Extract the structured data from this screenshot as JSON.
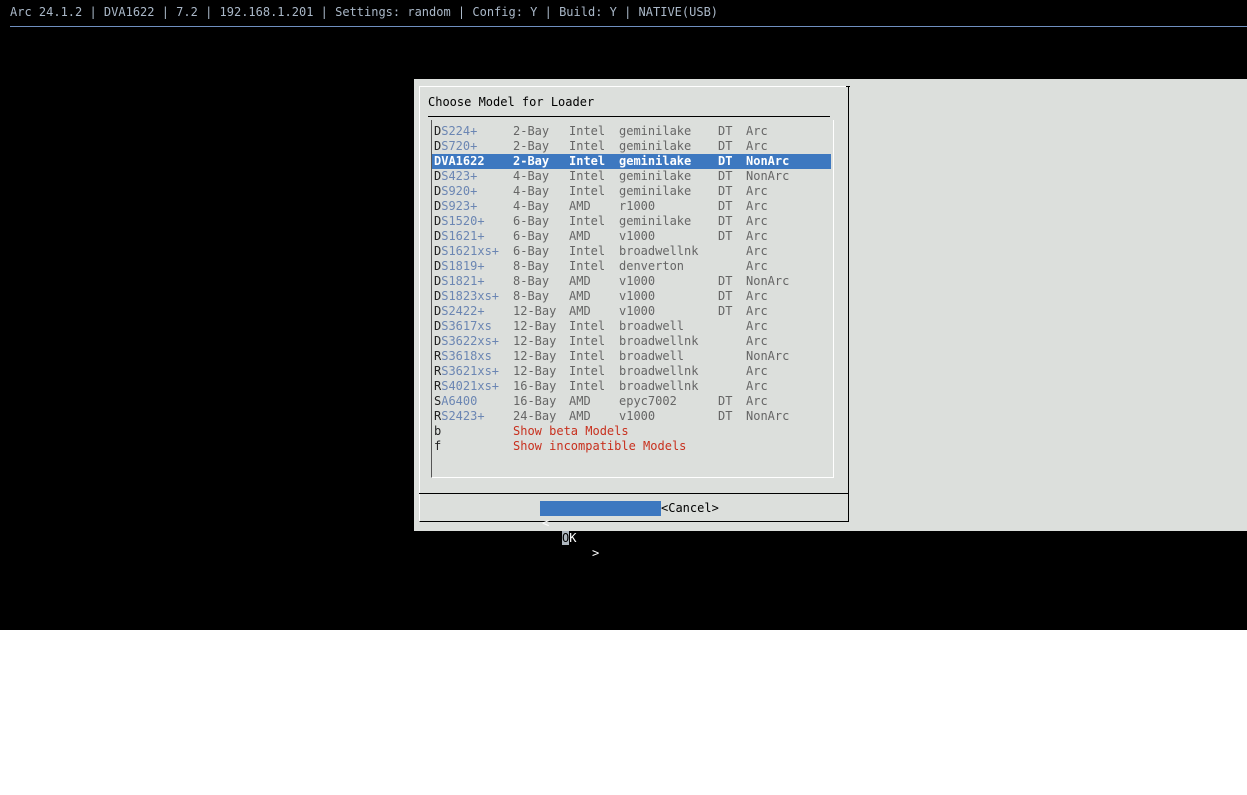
{
  "status_bar": "Arc 24.1.2 | DVA1622 | 7.2 | 192.168.1.201 | Settings: random | Config: Y | Build: Y | NATIVE(USB)",
  "dialog": {
    "title": "Choose Model for Loader",
    "ok_prefix": "<",
    "ok_label_hot": "O",
    "ok_label_rest": "K",
    "ok_suffix": ">",
    "cancel_label": "<Cancel>"
  },
  "models": [
    {
      "key": "D",
      "rest": "S224+",
      "bays": "2-Bay",
      "cpu": "Intel",
      "platform": "geminilake",
      "dt": "DT",
      "arc": "Arc"
    },
    {
      "key": "D",
      "rest": "S720+",
      "bays": "2-Bay",
      "cpu": "Intel",
      "platform": "geminilake",
      "dt": "DT",
      "arc": "Arc"
    },
    {
      "key": "D",
      "rest": "VA1622",
      "bays": "2-Bay",
      "cpu": "Intel",
      "platform": "geminilake",
      "dt": "DT",
      "arc": "NonArc",
      "selected": true
    },
    {
      "key": "D",
      "rest": "S423+",
      "bays": "4-Bay",
      "cpu": "Intel",
      "platform": "geminilake",
      "dt": "DT",
      "arc": "NonArc"
    },
    {
      "key": "D",
      "rest": "S920+",
      "bays": "4-Bay",
      "cpu": "Intel",
      "platform": "geminilake",
      "dt": "DT",
      "arc": "Arc"
    },
    {
      "key": "D",
      "rest": "S923+",
      "bays": "4-Bay",
      "cpu": "AMD",
      "platform": "r1000",
      "dt": "DT",
      "arc": "Arc"
    },
    {
      "key": "D",
      "rest": "S1520+",
      "bays": "6-Bay",
      "cpu": "Intel",
      "platform": "geminilake",
      "dt": "DT",
      "arc": "Arc"
    },
    {
      "key": "D",
      "rest": "S1621+",
      "bays": "6-Bay",
      "cpu": "AMD",
      "platform": "v1000",
      "dt": "DT",
      "arc": "Arc"
    },
    {
      "key": "D",
      "rest": "S1621xs+",
      "bays": "6-Bay",
      "cpu": "Intel",
      "platform": "broadwellnk",
      "dt": "",
      "arc": "Arc"
    },
    {
      "key": "D",
      "rest": "S1819+",
      "bays": "8-Bay",
      "cpu": "Intel",
      "platform": "denverton",
      "dt": "",
      "arc": "Arc"
    },
    {
      "key": "D",
      "rest": "S1821+",
      "bays": "8-Bay",
      "cpu": "AMD",
      "platform": "v1000",
      "dt": "DT",
      "arc": "NonArc"
    },
    {
      "key": "D",
      "rest": "S1823xs+",
      "bays": "8-Bay",
      "cpu": "AMD",
      "platform": "v1000",
      "dt": "DT",
      "arc": "Arc"
    },
    {
      "key": "D",
      "rest": "S2422+",
      "bays": "12-Bay",
      "cpu": "AMD",
      "platform": "v1000",
      "dt": "DT",
      "arc": "Arc"
    },
    {
      "key": "D",
      "rest": "S3617xs",
      "bays": "12-Bay",
      "cpu": "Intel",
      "platform": "broadwell",
      "dt": "",
      "arc": "Arc"
    },
    {
      "key": "D",
      "rest": "S3622xs+",
      "bays": "12-Bay",
      "cpu": "Intel",
      "platform": "broadwellnk",
      "dt": "",
      "arc": "Arc"
    },
    {
      "key": "R",
      "rest": "S3618xs",
      "bays": "12-Bay",
      "cpu": "Intel",
      "platform": "broadwell",
      "dt": "",
      "arc": "NonArc"
    },
    {
      "key": "R",
      "rest": "S3621xs+",
      "bays": "12-Bay",
      "cpu": "Intel",
      "platform": "broadwellnk",
      "dt": "",
      "arc": "Arc"
    },
    {
      "key": "R",
      "rest": "S4021xs+",
      "bays": "16-Bay",
      "cpu": "Intel",
      "platform": "broadwellnk",
      "dt": "",
      "arc": "Arc"
    },
    {
      "key": "S",
      "rest": "A6400",
      "bays": "16-Bay",
      "cpu": "AMD",
      "platform": "epyc7002",
      "dt": "DT",
      "arc": "Arc"
    },
    {
      "key": "R",
      "rest": "S2423+",
      "bays": "24-Bay",
      "cpu": "AMD",
      "platform": "v1000",
      "dt": "DT",
      "arc": "NonArc"
    }
  ],
  "extras": [
    {
      "key": "b",
      "label": "Show beta Models"
    },
    {
      "key": "f",
      "label": "Show incompatible Models"
    }
  ],
  "colors": {
    "selected": "#3d78c0",
    "link": "#6b86b3",
    "warning": "#c8301e"
  }
}
